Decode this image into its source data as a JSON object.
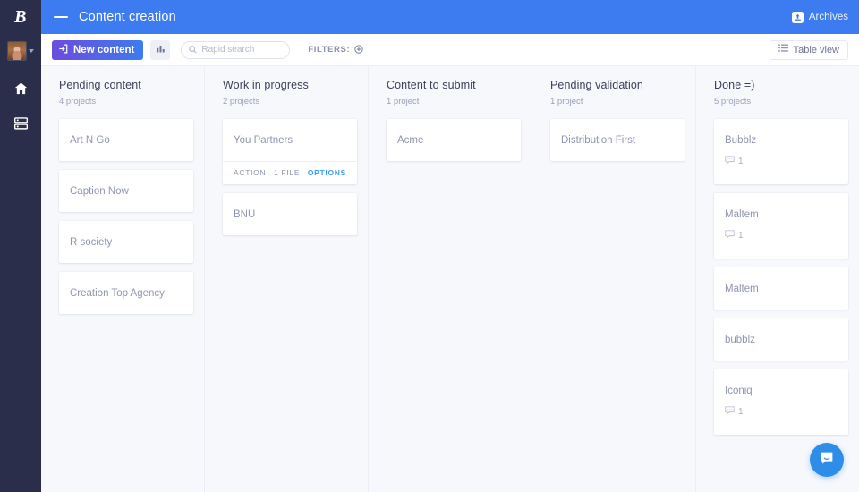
{
  "rail": {
    "logo": "B",
    "items": [
      {
        "name": "home",
        "label": "Home"
      },
      {
        "name": "projects",
        "label": "Projects"
      }
    ]
  },
  "topbar": {
    "menu_label": "Menu",
    "title": "Content creation",
    "archives_label": "Archives"
  },
  "toolbar": {
    "new_content_label": "New content",
    "stats_label": "Statistics",
    "search_placeholder": "Rapid search",
    "search_value": "",
    "filters_label": "FILTERS:",
    "table_view_label": "Table view"
  },
  "colors": {
    "brand_blue": "#3d7bf0",
    "rail_dark": "#2b2e4a",
    "accent_purple": "#6b4ddd",
    "link_blue": "#3d9bf0",
    "board_bg": "#f7f8fc",
    "launcher_blue": "#2f8dea"
  },
  "board": {
    "columns": [
      {
        "title": "Pending content",
        "count": "4 projects",
        "cards": [
          {
            "title": "Art N Go"
          },
          {
            "title": "Caption Now"
          },
          {
            "title": "R society"
          },
          {
            "title": "Creation Top Agency"
          }
        ]
      },
      {
        "title": "Work in progress",
        "count": "2 projects",
        "cards": [
          {
            "title": "You Partners",
            "actions": {
              "action": "ACTION",
              "files": "1 FILE",
              "options": "OPTIONS"
            }
          },
          {
            "title": "BNU"
          }
        ]
      },
      {
        "title": "Content to submit",
        "count": "1 project",
        "cards": [
          {
            "title": "Acme"
          }
        ]
      },
      {
        "title": "Pending validation",
        "count": "1 project",
        "cards": [
          {
            "title": "Distribution First"
          }
        ]
      },
      {
        "title": "Done =)",
        "count": "5 projects",
        "cards": [
          {
            "title": "Bubblz",
            "comments": "1"
          },
          {
            "title": "Maltem",
            "comments": "1"
          },
          {
            "title": "Maltem"
          },
          {
            "title": "bubblz"
          },
          {
            "title": "Iconiq",
            "comments": "1"
          }
        ]
      }
    ]
  },
  "launcher": {
    "label": "Open chat"
  }
}
